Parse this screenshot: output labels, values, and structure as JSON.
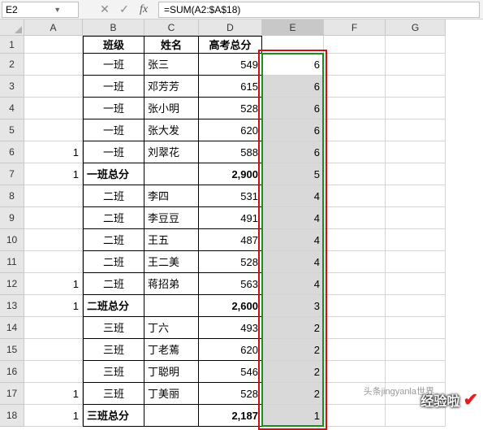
{
  "name_box": "E2",
  "formula": "=SUM(A2:$A$18)",
  "col_headers": [
    "A",
    "B",
    "C",
    "D",
    "E",
    "F",
    "G"
  ],
  "row_headers": [
    "1",
    "2",
    "3",
    "4",
    "5",
    "6",
    "7",
    "8",
    "9",
    "10",
    "11",
    "12",
    "13",
    "14",
    "15",
    "16",
    "17",
    "18"
  ],
  "header_row": {
    "B": "班级",
    "C": "姓名",
    "D": "高考总分"
  },
  "rows": [
    {
      "A": "",
      "B": "一班",
      "C": "张三",
      "D": "549",
      "E": "6"
    },
    {
      "A": "",
      "B": "一班",
      "C": "邓芳芳",
      "D": "615",
      "E": "6"
    },
    {
      "A": "",
      "B": "一班",
      "C": "张小明",
      "D": "528",
      "E": "6"
    },
    {
      "A": "",
      "B": "一班",
      "C": "张大发",
      "D": "620",
      "E": "6"
    },
    {
      "A": "1",
      "B": "一班",
      "C": "刘翠花",
      "D": "588",
      "E": "6"
    },
    {
      "A": "1",
      "B": "一班总分",
      "C": "",
      "D": "2,900",
      "E": "5",
      "bold": true
    },
    {
      "A": "",
      "B": "二班",
      "C": "李四",
      "D": "531",
      "E": "4"
    },
    {
      "A": "",
      "B": "二班",
      "C": "李豆豆",
      "D": "491",
      "E": "4"
    },
    {
      "A": "",
      "B": "二班",
      "C": "王五",
      "D": "487",
      "E": "4"
    },
    {
      "A": "",
      "B": "二班",
      "C": "王二美",
      "D": "528",
      "E": "4"
    },
    {
      "A": "1",
      "B": "二班",
      "C": "蒋招弟",
      "D": "563",
      "E": "4"
    },
    {
      "A": "1",
      "B": "二班总分",
      "C": "",
      "D": "2,600",
      "E": "3",
      "bold": true
    },
    {
      "A": "",
      "B": "三班",
      "C": "丁六",
      "D": "493",
      "E": "2"
    },
    {
      "A": "",
      "B": "三班",
      "C": "丁老蔫",
      "D": "620",
      "E": "2"
    },
    {
      "A": "",
      "B": "三班",
      "C": "丁聪明",
      "D": "546",
      "E": "2"
    },
    {
      "A": "1",
      "B": "三班",
      "C": "丁美丽",
      "D": "528",
      "E": "2"
    },
    {
      "A": "1",
      "B": "三班总分",
      "C": "",
      "D": "2,187",
      "E": "1",
      "bold": true
    }
  ],
  "watermark": "经验啦",
  "watermark2": "头条jingyanla世界"
}
